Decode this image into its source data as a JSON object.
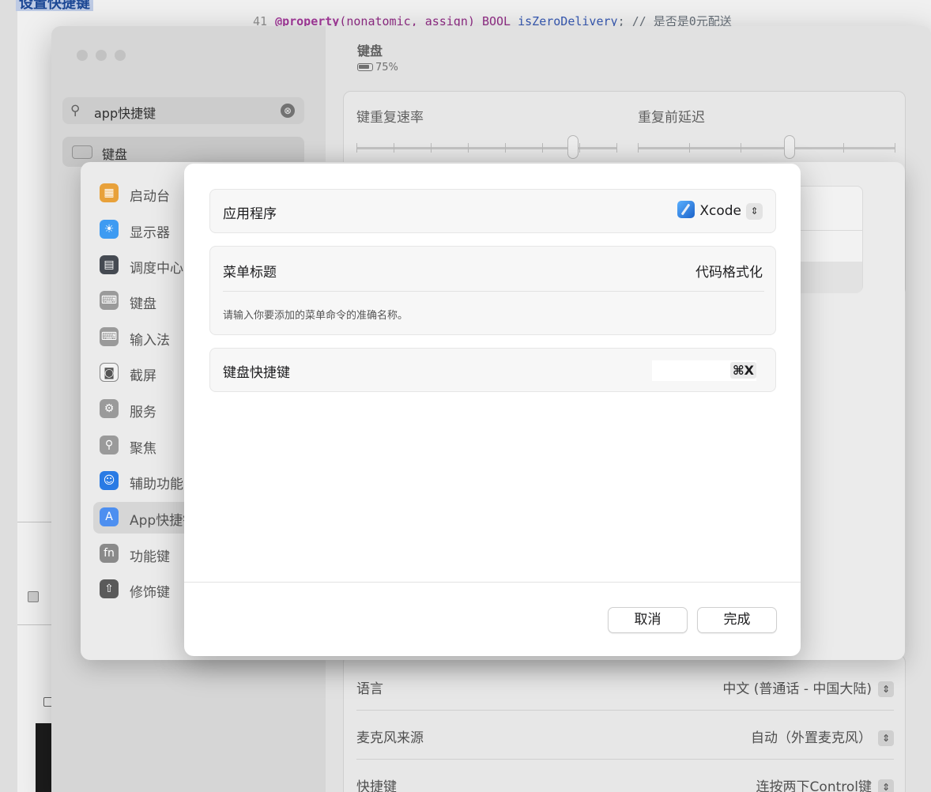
{
  "background_editor": {
    "label": "设置快捷键",
    "code": {
      "line_number": "41",
      "keyword": "@property",
      "attrs": "(nonatomic, assign) BOOL ",
      "identifier": "isZeroDelivery",
      "comment": "; // 是否是0元配送"
    }
  },
  "settings": {
    "search": {
      "value": "app快捷键",
      "clear_icon": "⊗"
    },
    "selected_result": "键盘",
    "content": {
      "title": "键盘",
      "battery": "75%",
      "key_repeat_rate_label": "键重复速率",
      "delay_until_repeat_label": "重复前延迟",
      "done_button": "完成",
      "rows": [
        {
          "label": "语言",
          "value": "中文 (普通话 - 中国大陆)"
        },
        {
          "label": "麦克风来源",
          "value": "自动（外置麦克风）"
        },
        {
          "label": "快捷键",
          "value": "连按两下Control键"
        }
      ]
    }
  },
  "shortcuts_sheet": {
    "nav_items": [
      {
        "label": "启动台",
        "icon": "launchpad-icon",
        "color": "#e8a13a"
      },
      {
        "label": "显示器",
        "icon": "display-icon",
        "color": "#3e9bf2"
      },
      {
        "label": "调度中心",
        "icon": "mission-control-icon",
        "color": "#454a52"
      },
      {
        "label": "键盘",
        "icon": "keyboard-icon",
        "color": "#9a9a9a"
      },
      {
        "label": "输入法",
        "icon": "input-sources-icon",
        "color": "#9a9a9a"
      },
      {
        "label": "截屏",
        "icon": "screenshot-icon",
        "color": "#f2f2f2"
      },
      {
        "label": "服务",
        "icon": "services-icon",
        "color": "#9a9a9a"
      },
      {
        "label": "聚焦",
        "icon": "spotlight-icon",
        "color": "#9a9a9a"
      },
      {
        "label": "辅助功能",
        "icon": "accessibility-icon",
        "color": "#2a7be4"
      },
      {
        "label": "App快捷键",
        "icon": "app-shortcuts-icon",
        "color": "#4d8ff0"
      },
      {
        "label": "功能键",
        "icon": "fn-icon",
        "color": "#8a8a8a"
      },
      {
        "label": "修饰键",
        "icon": "modifier-keys-icon",
        "color": "#5a5a5a"
      }
    ]
  },
  "dialog": {
    "application_label": "应用程序",
    "application_value": "Xcode",
    "menu_title_label": "菜单标题",
    "menu_title_value": "代码格式化",
    "menu_title_hint": "请输入你要添加的菜单命令的准确名称。",
    "shortcut_label": "键盘快捷键",
    "shortcut_value": "⌘X",
    "cancel_button": "取消",
    "done_button": "完成"
  }
}
